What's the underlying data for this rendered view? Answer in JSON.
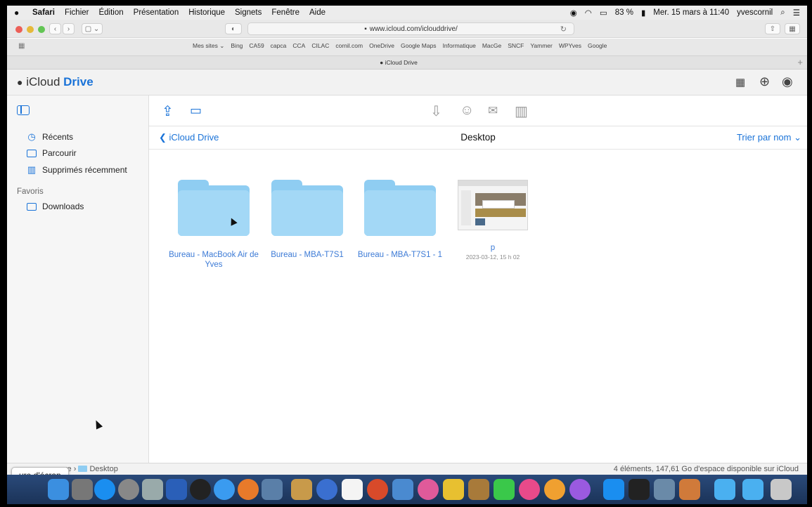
{
  "menubar": {
    "items": [
      "Safari",
      "Fichier",
      "Édition",
      "Présentation",
      "Historique",
      "Signets",
      "Fenêtre",
      "Aide"
    ],
    "battery": "83 %",
    "clock": "Mer. 15 mars à 11:40",
    "user": "yvescornil"
  },
  "browser": {
    "url": "www.icloud.com/iclouddrive/",
    "favorites": [
      "Mes sites ⌄",
      "Bing",
      "CA59",
      "capca",
      "CCA",
      "CILAC",
      "cornil.com",
      "OneDrive",
      "Google Maps",
      "Informatique",
      "MacGe",
      "SNCF",
      "Yammer",
      "WPYves",
      "Google"
    ],
    "tab_title": "iCloud Drive"
  },
  "header": {
    "brand": "iCloud",
    "product": "Drive"
  },
  "sidebar": {
    "items": [
      {
        "label": "Récents",
        "icon": "clock-icon"
      },
      {
        "label": "Parcourir",
        "icon": "folder-icon"
      },
      {
        "label": "Supprimés récemment",
        "icon": "trash-icon"
      }
    ],
    "favorites_title": "Favoris",
    "favorites": [
      {
        "label": "Downloads",
        "icon": "folder-icon"
      }
    ]
  },
  "content": {
    "back_label": "iCloud Drive",
    "title": "Desktop",
    "sort_label": "Trier par nom ⌄",
    "items": [
      {
        "name": "Bureau - MacBook Air de Yves",
        "type": "folder"
      },
      {
        "name": "Bureau - MBA-T7S1",
        "type": "folder"
      },
      {
        "name": "Bureau - MBA-T7S1 - 1",
        "type": "folder"
      },
      {
        "name": "p",
        "type": "image",
        "date": "2023-03-12, 15 h 02"
      }
    ]
  },
  "status": {
    "path_prefix": "ve",
    "path_folder": "Desktop",
    "storage": "4 éléments, 147,61 Go d'espace disponible sur iCloud",
    "tooltip": "ure d'écran"
  },
  "colors": {
    "accent": "#1a73d8",
    "folder": "#a3d8f6",
    "item_label": "#3d7bd6"
  }
}
